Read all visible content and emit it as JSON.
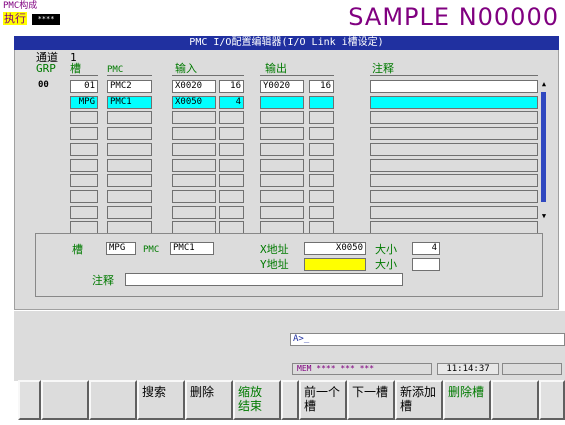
{
  "header": {
    "screen_line1": "PMC构成",
    "screen_line2": "执行",
    "badge": "****",
    "program": "SAMPLE N00000"
  },
  "editor": {
    "title": "PMC I/O配置编辑器(I/O Link i槽设定)",
    "channel_label": "通道",
    "channel_value": "1",
    "columns": {
      "grp": "GRP",
      "slot": "槽",
      "pmc": "PMC",
      "input": "输入",
      "output": "输出",
      "comment": "注释"
    },
    "rows": [
      {
        "grp": "00",
        "slot": "01",
        "pmc": "PMC2",
        "input": "X0020",
        "in_size": "16",
        "output": "Y0020",
        "out_size": "16",
        "comment": ""
      },
      {
        "grp": "",
        "slot": "MPG",
        "pmc": "PMC1",
        "input": "X0050",
        "in_size": "4",
        "output": "",
        "out_size": "",
        "comment": ""
      },
      {
        "grp": "",
        "slot": "",
        "pmc": "",
        "input": "",
        "in_size": "",
        "output": "",
        "out_size": "",
        "comment": ""
      },
      {
        "grp": "",
        "slot": "",
        "pmc": "",
        "input": "",
        "in_size": "",
        "output": "",
        "out_size": "",
        "comment": ""
      },
      {
        "grp": "",
        "slot": "",
        "pmc": "",
        "input": "",
        "in_size": "",
        "output": "",
        "out_size": "",
        "comment": ""
      },
      {
        "grp": "",
        "slot": "",
        "pmc": "",
        "input": "",
        "in_size": "",
        "output": "",
        "out_size": "",
        "comment": ""
      },
      {
        "grp": "",
        "slot": "",
        "pmc": "",
        "input": "",
        "in_size": "",
        "output": "",
        "out_size": "",
        "comment": ""
      },
      {
        "grp": "",
        "slot": "",
        "pmc": "",
        "input": "",
        "in_size": "",
        "output": "",
        "out_size": "",
        "comment": ""
      },
      {
        "grp": "",
        "slot": "",
        "pmc": "",
        "input": "",
        "in_size": "",
        "output": "",
        "out_size": "",
        "comment": ""
      },
      {
        "grp": "",
        "slot": "",
        "pmc": "",
        "input": "",
        "in_size": "",
        "output": "",
        "out_size": "",
        "comment": ""
      }
    ],
    "selected_row": 1
  },
  "detail": {
    "slot_label": "槽",
    "slot_value": "MPG",
    "pmc_label": "PMC",
    "pmc_value": "PMC1",
    "x_addr_label": "X地址",
    "x_addr_value": "X0050",
    "x_size_label": "大小",
    "x_size_value": "4",
    "y_addr_label": "Y地址",
    "y_addr_value": "",
    "y_size_label": "大小",
    "y_size_value": "",
    "comment_label": "注释",
    "comment_value": ""
  },
  "command": {
    "prompt": "A>_"
  },
  "status": {
    "mode": "MEM  **** *** ***",
    "time": "11:14:37"
  },
  "softkeys": [
    "",
    "",
    "",
    "搜索",
    "删除",
    "缩放\n结束",
    "",
    "前一个\n槽",
    "下一槽",
    "新添加\n槽",
    "删除槽",
    "",
    ""
  ],
  "colors": {
    "title_bar": "#2030a0",
    "selection": "#00ffff",
    "address_highlight": "#ffff00",
    "label_green": "#007a00",
    "program_purple": "#800080"
  }
}
